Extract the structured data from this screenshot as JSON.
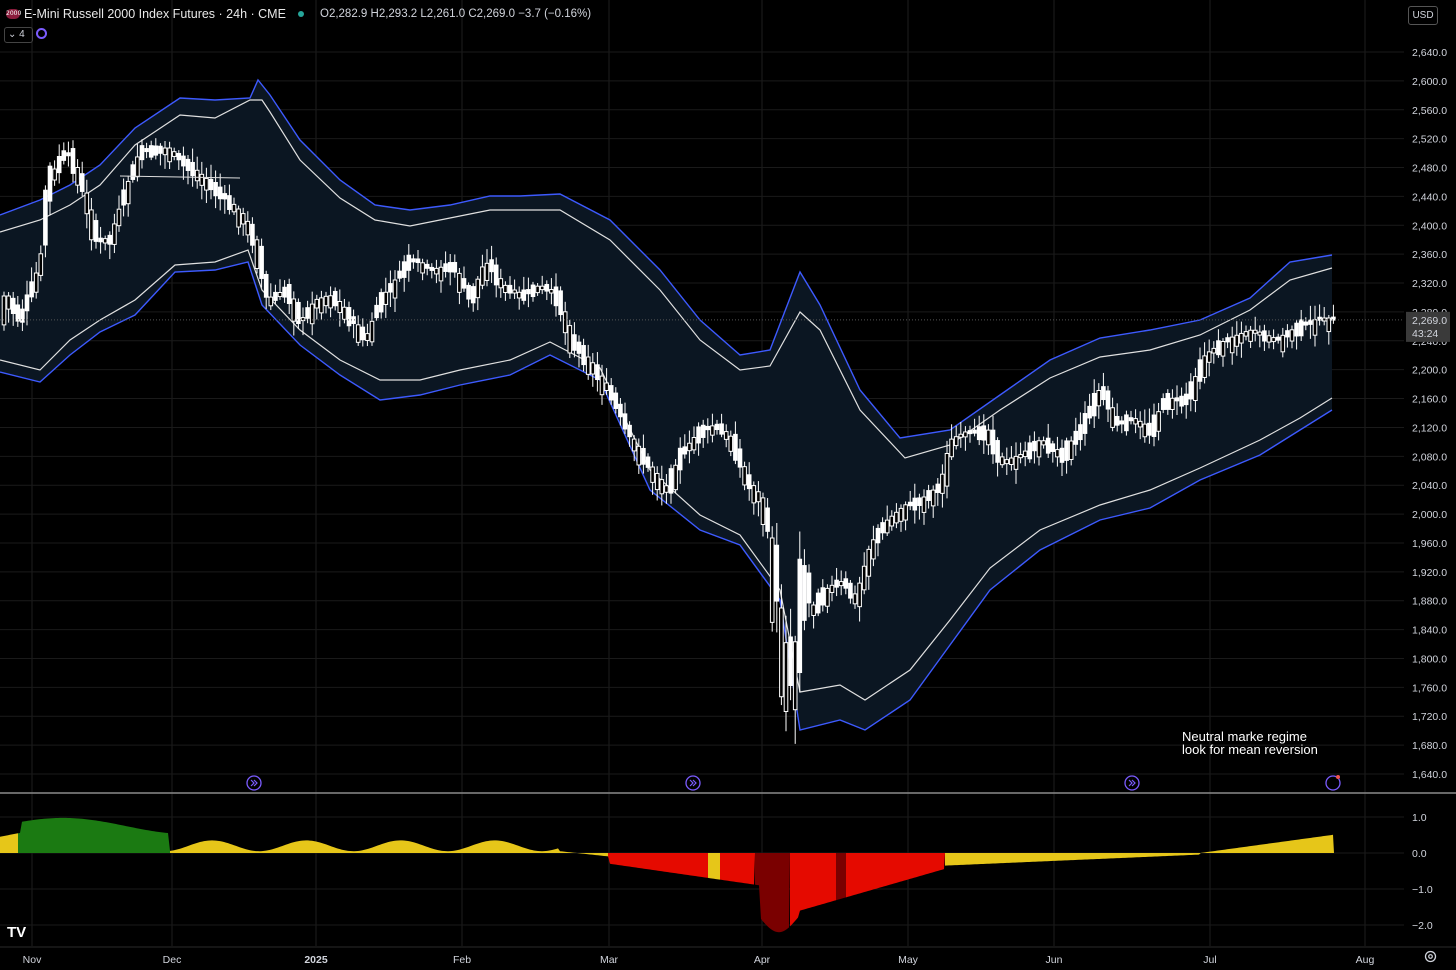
{
  "header": {
    "logo_text": "2000",
    "title": "E-Mini Russell 2000 Index Futures · 24h · CME",
    "ohlc": "O2,282.9 H2,293.2 L2,261.0 C2,269.0 −3.7 (−0.16%)",
    "currency": "USD",
    "indicator_count": "4"
  },
  "price_axis": {
    "labels": [
      "2,640.0",
      "2,600.0",
      "2,560.0",
      "2,520.0",
      "2,480.0",
      "2,440.0",
      "2,400.0",
      "2,360.0",
      "2,320.0",
      "2,280.0",
      "2,240.0",
      "2,200.0",
      "2,160.0",
      "2,120.0",
      "2,080.0",
      "2,040.0",
      "2,000.0",
      "1,960.0",
      "1,920.0",
      "1,880.0",
      "1,840.0",
      "1,800.0",
      "1,760.0",
      "1,720.0",
      "1,680.0",
      "1,640.0"
    ],
    "last_price": "2,269.0",
    "countdown": "43:24"
  },
  "oscillator_axis": {
    "labels": [
      "1.0",
      "0.0",
      "−1.0",
      "−2.0"
    ]
  },
  "time_axis": {
    "labels": [
      "Nov",
      "Dec",
      "2025",
      "Feb",
      "Mar",
      "Apr",
      "May",
      "Jun",
      "Jul",
      "Aug"
    ]
  },
  "annotation": {
    "line1": "Neutral marke regime",
    "line2": "look for mean reversion"
  },
  "brand": {
    "text": "TV"
  },
  "colors": {
    "background": "#000000",
    "candle": "#ffffff",
    "outer_band": "#3d5afe",
    "inner_band": "#e0e0e0",
    "band_fill": "#0b1622",
    "osc_green": "#1b7a12",
    "osc_yellow": "#e6c619",
    "osc_red": "#e50a00",
    "osc_darkred": "#7a0000"
  },
  "chart_data": {
    "type": "candlestick",
    "price_range": [
      1640,
      2640
    ],
    "series": [
      {
        "name": "close",
        "x": [
          "Nov",
          "Dec",
          "2025",
          "Feb",
          "Mar",
          "Apr",
          "May",
          "Jun",
          "Jul"
        ],
        "values": [
          2380,
          2470,
          2240,
          2330,
          2240,
          1870,
          2020,
          2110,
          2240
        ]
      }
    ],
    "last": 2269.0,
    "oscillator_range": [
      -2.3,
      1.3
    ]
  }
}
